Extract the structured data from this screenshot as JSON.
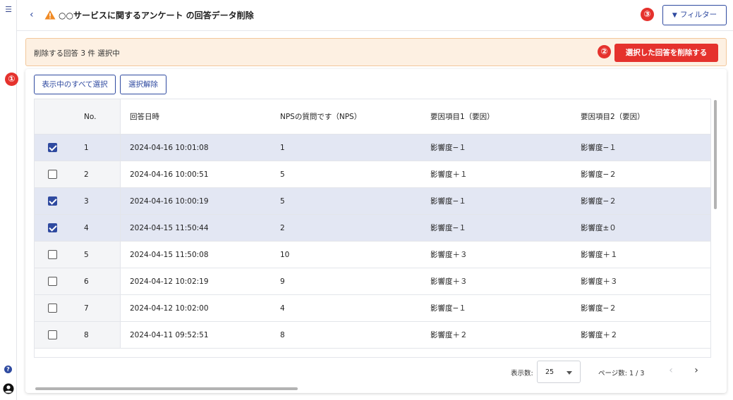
{
  "header": {
    "title": "○○サービスに関するアンケート の回答データ削除",
    "filter_label": "フィルター",
    "badge3": "③"
  },
  "banner": {
    "text": "削除する回答 3 件 選択中",
    "delete_label": "選択した回答を削除する",
    "badge2": "②"
  },
  "badge1": "①",
  "toolbar": {
    "select_all_label": "表示中のすべて選択",
    "deselect_label": "選択解除"
  },
  "table": {
    "columns": [
      "No.",
      "回答日時",
      "NPSの質問です（NPS）",
      "要因項目1（要因）",
      "要因項目2（要因）"
    ],
    "rows": [
      {
        "checked": true,
        "no": "1",
        "datetime": "2024-04-16 10:01:08",
        "nps": "1",
        "factor1": "影響度−１",
        "factor2": "影響度−１"
      },
      {
        "checked": false,
        "no": "2",
        "datetime": "2024-04-16 10:00:51",
        "nps": "5",
        "factor1": "影響度＋１",
        "factor2": "影響度−２"
      },
      {
        "checked": true,
        "no": "3",
        "datetime": "2024-04-16 10:00:19",
        "nps": "5",
        "factor1": "影響度−１",
        "factor2": "影響度−２"
      },
      {
        "checked": true,
        "no": "4",
        "datetime": "2024-04-15 11:50:44",
        "nps": "2",
        "factor1": "影響度−１",
        "factor2": "影響度±０"
      },
      {
        "checked": false,
        "no": "5",
        "datetime": "2024-04-15 11:50:08",
        "nps": "10",
        "factor1": "影響度＋３",
        "factor2": "影響度＋１"
      },
      {
        "checked": false,
        "no": "6",
        "datetime": "2024-04-12 10:02:19",
        "nps": "9",
        "factor1": "影響度＋３",
        "factor2": "影響度＋３"
      },
      {
        "checked": false,
        "no": "7",
        "datetime": "2024-04-12 10:02:00",
        "nps": "4",
        "factor1": "影響度−１",
        "factor2": "影響度−２"
      },
      {
        "checked": false,
        "no": "8",
        "datetime": "2024-04-11 09:52:51",
        "nps": "8",
        "factor1": "影響度＋２",
        "factor2": "影響度＋２"
      }
    ]
  },
  "pager": {
    "per_page_label": "表示数:",
    "per_page_value": "25",
    "page_info": "ページ数: 1 / 3"
  },
  "colors": {
    "accent": "#2f4aa0",
    "danger": "#e5322d",
    "banner_bg": "#fdf0e2",
    "selected_row": "#e3e7f3"
  }
}
